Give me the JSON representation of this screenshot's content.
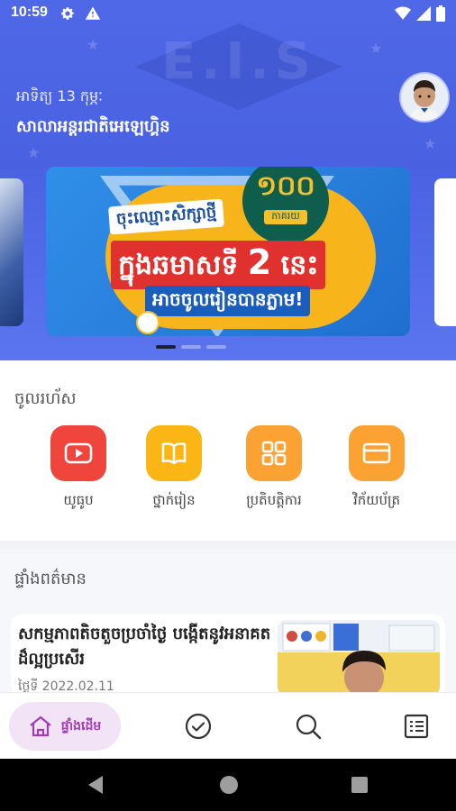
{
  "status_bar": {
    "time": "10:59",
    "left_icons": [
      "gear-icon",
      "warning-icon"
    ],
    "right_icons": [
      "wifi-icon",
      "signal-icon",
      "battery-icon"
    ]
  },
  "header": {
    "watermark": "E.I.S",
    "date": "អាទិត្យ 13 កុម្ភៈ",
    "school_name": "សាលាអន្តរជាតិអេឡេហ្គិន"
  },
  "banner": {
    "badge_number": "១០០",
    "badge_unit": "ភាគរយ",
    "line1": "ចុះឈ្មោះសិក្សាថ្មី",
    "line2_prefix": "ក្នុងឆមាសទី",
    "line2_number": "2",
    "line2_suffix": "នេះ",
    "line3": "អាចចូលរៀនបានភ្លាម!",
    "slide_count": 3,
    "active_slide": 1
  },
  "shortcuts": {
    "title": "ចូលរហ័ស",
    "items": [
      {
        "label": "យូធូប",
        "icon": "youtube-play-icon",
        "color": "#f0453c"
      },
      {
        "label": "ថ្នាក់រៀន",
        "icon": "book-icon",
        "color": "#fbb615"
      },
      {
        "label": "ប្រតិបត្តិការ",
        "icon": "grid-icon",
        "color": "#fba232"
      },
      {
        "label": "វិក័យប័ត្រ",
        "icon": "card-icon",
        "color": "#fba232"
      }
    ]
  },
  "news": {
    "title": "ផ្ទាំងពត៌មាន",
    "items": [
      {
        "title": "សកម្មភាពតិចតួចប្រចាំថ្ងៃ បង្កើតនូវអនាគតដ៏ល្អប្រសើរ",
        "date": "ថ្ងៃទី 2022.02.11"
      }
    ]
  },
  "bottom_nav": {
    "items": [
      {
        "label": "ផ្ទាំងដើម",
        "icon": "home-icon",
        "active": true
      },
      {
        "label": "",
        "icon": "check-circle-icon",
        "active": false
      },
      {
        "label": "",
        "icon": "search-icon",
        "active": false
      },
      {
        "label": "",
        "icon": "list-icon",
        "active": false
      }
    ]
  },
  "system_nav": {
    "buttons": [
      "back-icon",
      "home-circle-icon",
      "recents-icon"
    ]
  },
  "colors": {
    "hero": "#4f68e8",
    "nav_active_bg": "#f3e3f6",
    "nav_active_fg": "#a23bb7"
  }
}
